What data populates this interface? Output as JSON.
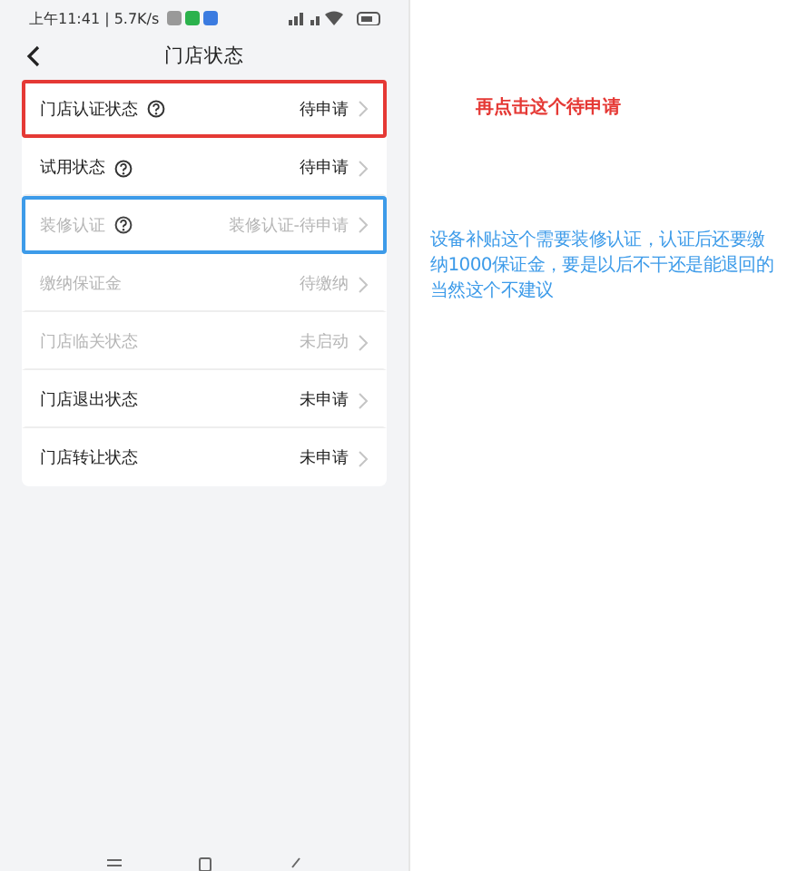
{
  "status_bar": {
    "time": "上午11:41 | 5.7K/s"
  },
  "header": {
    "title": "门店状态"
  },
  "rows": [
    {
      "label": "门店认证状态",
      "help": true,
      "status": "待申请",
      "disabled": false,
      "color": "#e53935"
    },
    {
      "label": "试用状态",
      "help": true,
      "status": "待申请",
      "disabled": false
    },
    {
      "label": "装修认证",
      "help": true,
      "status": "装修认证-待申请",
      "disabled": true,
      "color": "#3d9be9"
    },
    {
      "label": "缴纳保证金",
      "help": false,
      "status": "待缴纳",
      "disabled": true
    },
    {
      "label": "门店临关状态",
      "help": false,
      "status": "未启动",
      "disabled": true
    },
    {
      "label": "门店退出状态",
      "help": false,
      "status": "未申请",
      "disabled": false
    },
    {
      "label": "门店转让状态",
      "help": false,
      "status": "未申请",
      "disabled": false
    }
  ],
  "annotations": [
    {
      "text": "再点击这个待申请",
      "color": "#e53935"
    },
    {
      "lines": [
        "设备补贴这个需要装修认证，认证后还要缴",
        "纳1000保证金，要是以后不干还是能退回的",
        "当然这个不建议"
      ],
      "color": "#3d9be9"
    }
  ]
}
